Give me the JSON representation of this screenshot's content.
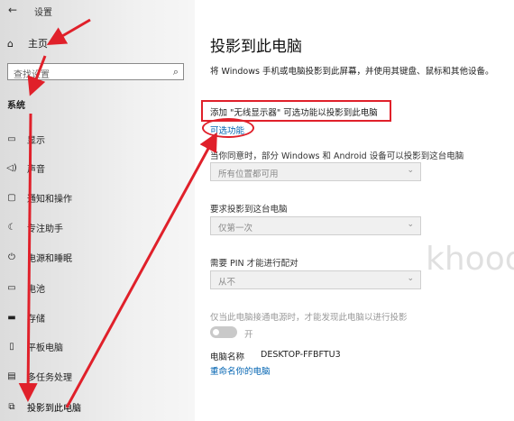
{
  "window": {
    "title": "设置"
  },
  "sidebar": {
    "home_label": "主页",
    "search_placeholder": "查找设置",
    "section_title": "系统",
    "items": [
      {
        "icon": "display-icon",
        "label": "显示"
      },
      {
        "icon": "sound-icon",
        "label": "声音"
      },
      {
        "icon": "notifications-icon",
        "label": "通知和操作"
      },
      {
        "icon": "focus-assist-icon",
        "label": "专注助手"
      },
      {
        "icon": "power-icon",
        "label": "电源和睡眠"
      },
      {
        "icon": "battery-icon",
        "label": "电池"
      },
      {
        "icon": "storage-icon",
        "label": "存储"
      },
      {
        "icon": "tablet-icon",
        "label": "平板电脑"
      },
      {
        "icon": "multitasking-icon",
        "label": "多任务处理"
      },
      {
        "icon": "project-icon",
        "label": "投影到此电脑"
      }
    ]
  },
  "main": {
    "title": "投影到此电脑",
    "description": "将 Windows 手机或电脑投影到此屏幕，并使用其键盘、鼠标和其他设备。",
    "add_text": "添加 \"无线显示器\" 可选功能以投影到此电脑",
    "optional_features_link": "可选功能",
    "settings": [
      {
        "label": "当你同意时，部分 Windows 和 Android 设备可以投影到这台电脑",
        "value": "所有位置都可用"
      },
      {
        "label": "要求投影到这台电脑",
        "value": "仅第一次"
      },
      {
        "label": "需要 PIN 才能进行配对",
        "value": "从不"
      }
    ],
    "power_note": "仅当此电脑接通电源时，才能发现此电脑以进行投影",
    "toggle_label": "开",
    "pc_name_label": "电脑名称",
    "pc_name_value": "DESKTOP-FFBFTU3",
    "rename_link": "重命名你的电脑"
  },
  "watermark": "khooo.com",
  "colors": {
    "accent": "#0063b1",
    "annotation": "#e0202a"
  }
}
